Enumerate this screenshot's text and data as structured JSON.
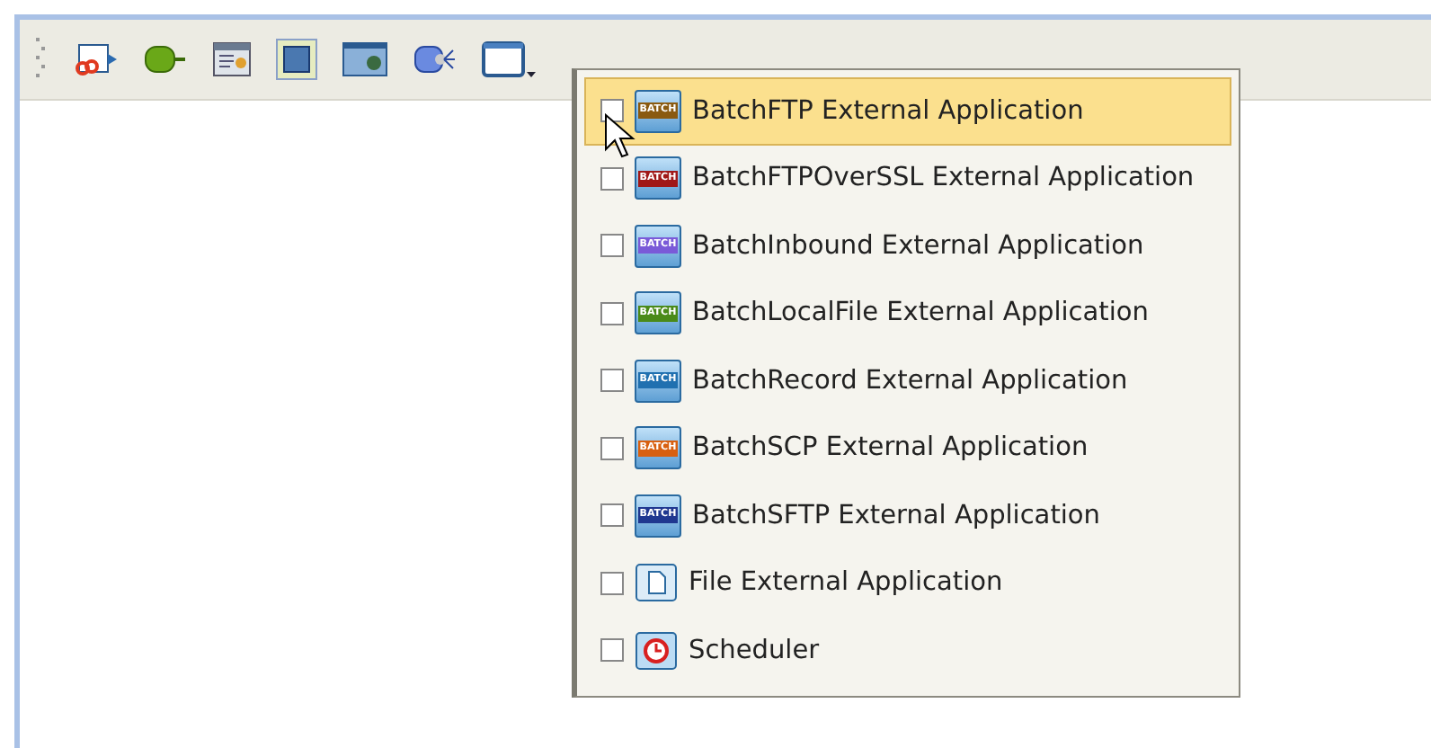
{
  "toolbar": {
    "buttons": [
      {
        "kind": "connector"
      },
      {
        "kind": "cylinder"
      },
      {
        "kind": "form"
      },
      {
        "kind": "frame"
      },
      {
        "kind": "image"
      },
      {
        "kind": "service"
      },
      {
        "kind": "window",
        "dropdown": true
      }
    ]
  },
  "menu": {
    "items": [
      {
        "label": "BatchFTP External Application",
        "checked": false,
        "selected": true,
        "kind": "batch",
        "badge": "BATCH",
        "color": "#8a5a10"
      },
      {
        "label": "BatchFTPOverSSL External Application",
        "checked": false,
        "selected": false,
        "kind": "batch",
        "badge": "BATCH",
        "color": "#a01818"
      },
      {
        "label": "BatchInbound External Application",
        "checked": false,
        "selected": false,
        "kind": "batch",
        "badge": "BATCH",
        "color": "#7a5ad8"
      },
      {
        "label": "BatchLocalFile External Application",
        "checked": false,
        "selected": false,
        "kind": "batch",
        "badge": "BATCH",
        "color": "#4a8a18"
      },
      {
        "label": "BatchRecord External Application",
        "checked": false,
        "selected": false,
        "kind": "batch",
        "badge": "BATCH",
        "color": "#2070b0"
      },
      {
        "label": "BatchSCP External Application",
        "checked": false,
        "selected": false,
        "kind": "batch",
        "badge": "BATCH",
        "color": "#d86010"
      },
      {
        "label": "BatchSFTP External Application",
        "checked": false,
        "selected": false,
        "kind": "batch",
        "badge": "BATCH",
        "color": "#203890"
      },
      {
        "label": "File External Application",
        "checked": false,
        "selected": false,
        "kind": "file"
      },
      {
        "label": "Scheduler",
        "checked": false,
        "selected": false,
        "kind": "clock"
      }
    ]
  }
}
